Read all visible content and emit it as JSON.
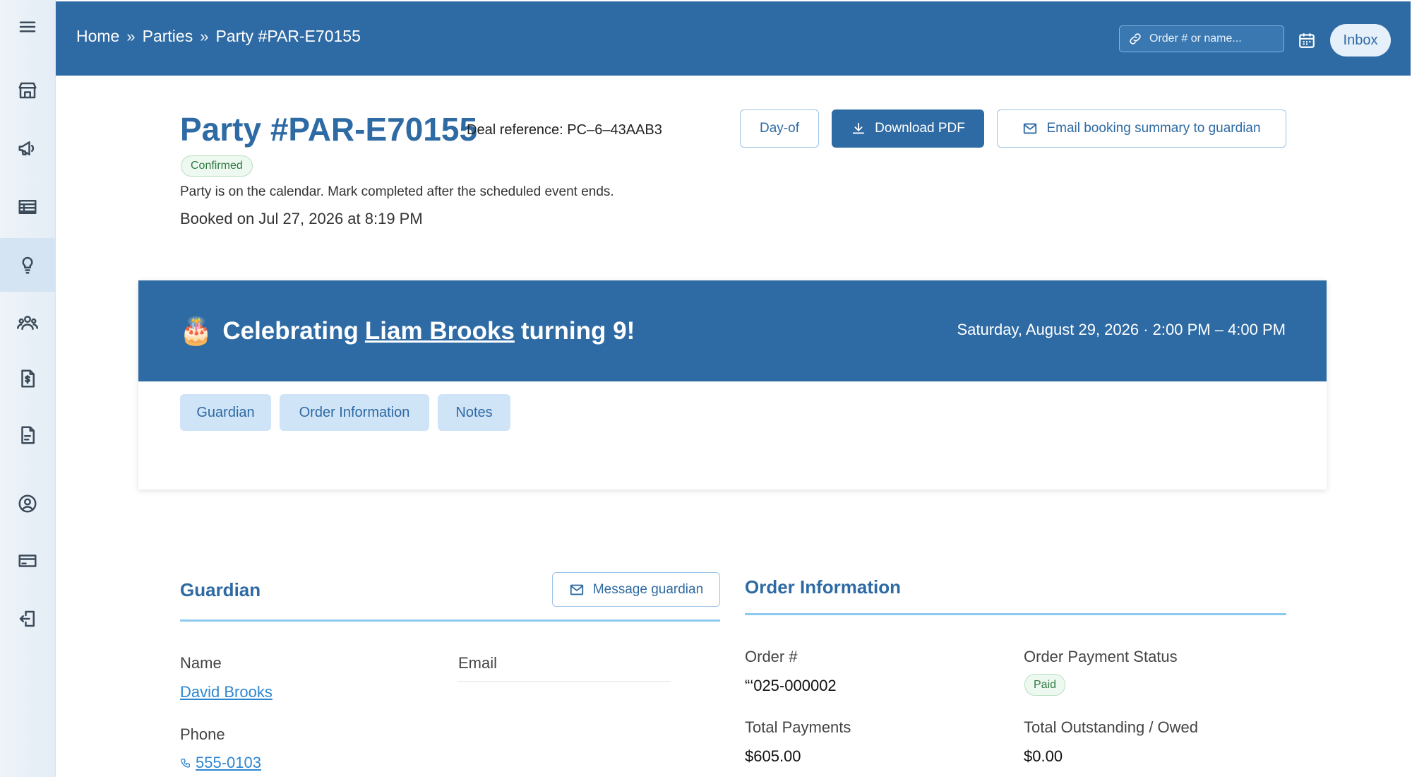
{
  "topbar": {
    "breadcrumb": [
      "Home",
      "Parties",
      "Party #PAR-E70155"
    ],
    "search_placeholder": "Order # or name...",
    "inbox_label": "Inbox"
  },
  "sidebar": {
    "items": [
      {
        "icon": "menu-icon"
      },
      {
        "icon": "storefront-icon"
      },
      {
        "icon": "megaphone-icon"
      },
      {
        "icon": "table-icon"
      },
      {
        "icon": "lightbulb-icon",
        "active": true
      },
      {
        "icon": "people-icon"
      },
      {
        "icon": "invoice-dollar-icon"
      },
      {
        "icon": "document-icon"
      },
      {
        "icon": "user-circle-icon"
      },
      {
        "icon": "credit-card-icon"
      },
      {
        "icon": "logout-icon"
      }
    ]
  },
  "header": {
    "title": "Party #PAR-E70155",
    "deal_reference": "Deal reference: PC–6–43AAB3",
    "status_badge": "Confirmed",
    "status_text": "Party is on the calendar. Mark completed after the scheduled event ends.",
    "booked_on": "Booked on Jul 27, 2026 at 8:19 PM",
    "actions": {
      "day_of": "Day-of",
      "download_pdf": "Download PDF",
      "email_summary": "Email booking summary to guardian"
    }
  },
  "banner": {
    "prefix": "Celebrating",
    "child_name": "Liam Brooks",
    "suffix": "turning 9!",
    "event_time": "Saturday, August 29, 2026 · 2:00 PM – 4:00 PM",
    "tabs": [
      "Guardian",
      "Order Information",
      "Notes"
    ]
  },
  "guardian": {
    "title": "Guardian",
    "message_button": "Message guardian",
    "name_label": "Name",
    "name_value": "David Brooks",
    "email_label": "Email",
    "phone_label": "Phone",
    "phone_value": "555-0103"
  },
  "order": {
    "title": "Order Information",
    "order_number_label": "Order #",
    "order_number_value": "“‘025-000002",
    "payment_status_label": "Order Payment Status",
    "payment_status_value": "Paid",
    "total_payments_label": "Total Payments",
    "total_payments_value": "$605.00",
    "outstanding_label": "Total Outstanding / Owed",
    "outstanding_value": "$0.00"
  },
  "colors": {
    "brand": "#2e6aa3",
    "link": "#2e86d1",
    "success_bg": "#edf9f0",
    "success_text": "#2f7a43"
  }
}
